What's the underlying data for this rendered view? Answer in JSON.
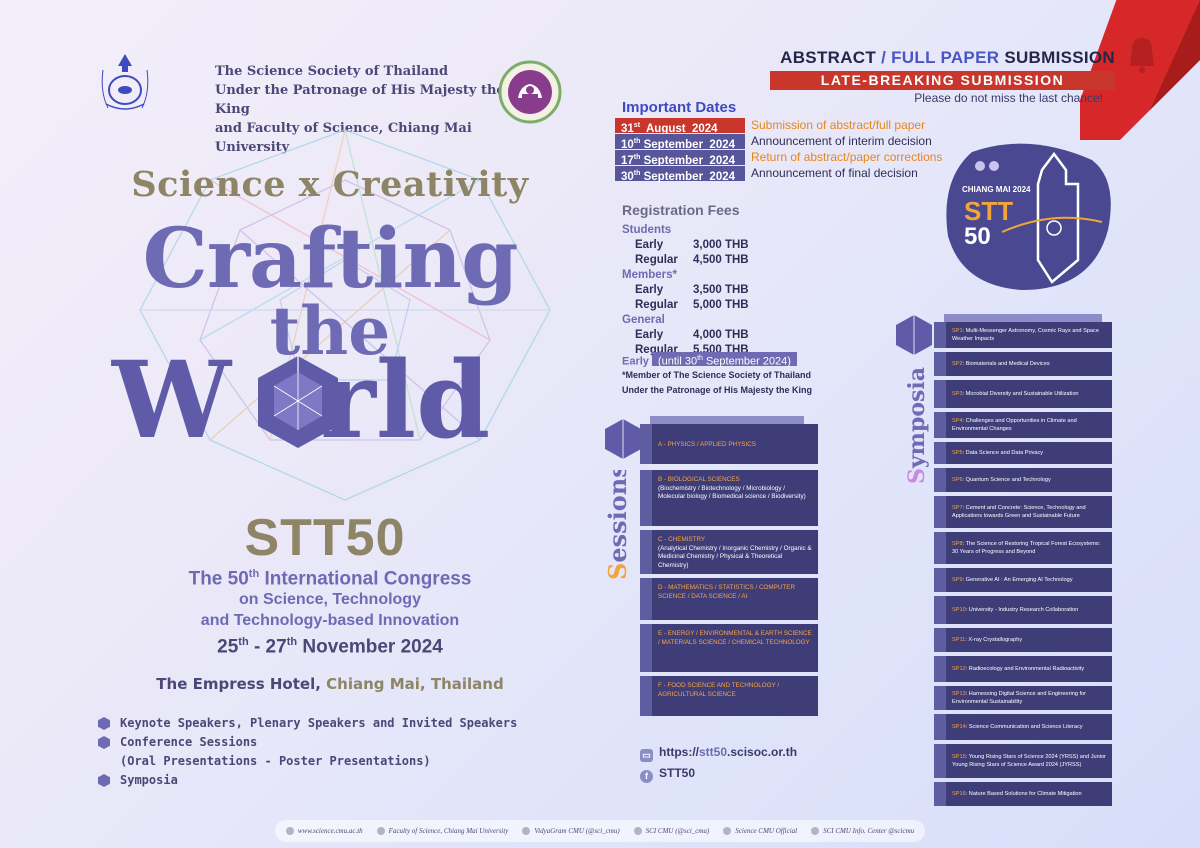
{
  "header": {
    "org_line1": "The Science Society of Thailand",
    "org_line2": "Under the Patronage of His Majesty the King",
    "org_line3": "and Faculty of Science, Chiang Mai University"
  },
  "hero": {
    "tagline": "Science x Creativity",
    "word1": "Crafting",
    "word2": "the",
    "word3_a": "W",
    "word3_b": "rld",
    "acronym": "STT50",
    "congress_prefix": "The 50",
    "congress_sup": "th",
    "congress_rest": " International Congress",
    "congress_line2": "on Science, Technology",
    "congress_line3": "and Technology-based Innovation",
    "date_start": "25",
    "date_start_sup": "th",
    "date_sep": " - 27",
    "date_end_sup": "th",
    "date_rest": " November 2024",
    "venue_main": "The Empress Hotel, ",
    "venue_city": "Chiang Mai, Thailand"
  },
  "features": [
    "Keynote Speakers, Plenary Speakers and Invited Speakers",
    "Conference Sessions",
    "(Oral Presentations - Poster Presentations)",
    "Symposia"
  ],
  "submission": {
    "title_a": "ABSTRACT ",
    "title_slash": "/ ",
    "title_b": "FULL PAPER ",
    "title_c": "SUBMISSION",
    "late": "LATE-BREAKING SUBMISSION",
    "note": "Please do not miss the last chance!"
  },
  "important_dates": {
    "title": "Important Dates",
    "rows": [
      {
        "day": "31",
        "sup": "st",
        "month": "  August  2024",
        "desc": "Submission of abstract/full paper",
        "pill_color": "#c9372c",
        "desc_color": "#e8861a"
      },
      {
        "day": "10",
        "sup": "th",
        "month": " September  2024",
        "desc": "Announcement of interim decision",
        "pill_color": "#57569a",
        "desc_color": "#2e2e58"
      },
      {
        "day": "17",
        "sup": "th",
        "month": " September  2024",
        "desc": "Return of abstract/paper corrections",
        "pill_color": "#57569a",
        "desc_color": "#e8861a"
      },
      {
        "day": "30",
        "sup": "th",
        "month": " September  2024",
        "desc": "Announcement of final decision",
        "pill_color": "#57569a",
        "desc_color": "#2e2e58"
      }
    ]
  },
  "registration": {
    "title": "Registration Fees",
    "students": "Students",
    "members": "Members*",
    "general": "General",
    "early": "Early",
    "regular": "Regular",
    "students_early": "3,000 THB",
    "students_regular": "4,500 THB",
    "members_early": "3,500 THB",
    "members_regular": "5,000 THB",
    "general_early": "4,000 THB",
    "general_regular": "5,500 THB",
    "early_label": "Early",
    "until_prefix": "(until 30",
    "until_sup": "th",
    "until_rest": " September  2024)",
    "note_line1": "*Member of The Science Society of Thailand",
    "note_line2": "Under the Patronage of His Majesty the King"
  },
  "badge": {
    "city": "CHIANG MAI 2024",
    "stt": "STT",
    "num": "50"
  },
  "sessions": {
    "heading_first": "S",
    "heading_rest": "essions",
    "items": [
      {
        "head": "A - PHYSICS / APPLIED PHYSICS",
        "body": ""
      },
      {
        "head": "B - BIOLOGICAL SCIENCES",
        "body": "(Biochemistry / Biotechnology / Microbiology / Molecular biology / Biomedical science / Biodiversity)"
      },
      {
        "head": "C - CHEMISTRY",
        "body": "(Analytical Chemistry / Inorganic Chemistry / Organic & Medicinal Chemistry / Physical & Theoretical Chemistry)"
      },
      {
        "head": "D - MATHEMATICS / STATISTICS / COMPUTER SCIENCE / DATA SCIENCE / AI",
        "body": ""
      },
      {
        "head": "E - ENERGY / ENVIRONMENTAL & EARTH SCIENCE / MATERIALS SCIENCE / CHEMICAL TECHNOLOGY",
        "body": ""
      },
      {
        "head": "F - FOOD SCIENCE AND TECHNOLOGY / AGRICULTURAL SCIENCE",
        "body": ""
      }
    ]
  },
  "symposia": {
    "heading_first": "S",
    "heading_rest": "ymposia",
    "items": [
      {
        "code": "SP1",
        "text": ": Multi-Messenger Astronomy, Cosmic Rays and Space Weather Impacts"
      },
      {
        "code": "SP2",
        "text": ": Biomaterials and Medical Devices"
      },
      {
        "code": "SP3",
        "text": ": Microbial Diversity and Sustainable Utilization"
      },
      {
        "code": "SP4",
        "text": ": Challenges and Opportunities in Climate and Environmental Changes"
      },
      {
        "code": "SP5",
        "text": ": Data Science and Data Privacy"
      },
      {
        "code": "SP6",
        "text": ": Quantum Science and Technology"
      },
      {
        "code": "SP7",
        "text": ": Cement and Concrete: Science, Technology and Applications towards Green and Sustainable Future"
      },
      {
        "code": "SP8",
        "text": ": The Science of Restoring Tropical Forest Ecosystems: 30 Years of Progress and Beyond"
      },
      {
        "code": "SP9",
        "text": ": Generative AI : An Emerging AI Technology"
      },
      {
        "code": "SP10",
        "text": ": University - Industry Research Collaboration"
      },
      {
        "code": "SP11",
        "text": ": X-ray Crystallography"
      },
      {
        "code": "SP12",
        "text": ":  Radioecology and Environmental Radioactivity"
      },
      {
        "code": "SP13",
        "text": ": Harnessing Digital Science and Engineering for Environmental Sustainability"
      },
      {
        "code": "SP14",
        "text": ": Science Communication and Science Literacy"
      },
      {
        "code": "SP15",
        "text": ": Young Rising Stars of Science 2024 (YRSS) and Junior Young Rising Stars of Science Award 2024 (JYRSS)"
      },
      {
        "code": "SP16",
        "text": ": Nature Based Solutions for Climate Mitigation"
      }
    ]
  },
  "links": {
    "site_prefix": "https://",
    "site_stt": "stt50",
    "site_rest": ".scisoc.or.th",
    "facebook": "STT50"
  },
  "footer": [
    {
      "icon": "globe-icon",
      "text": "www.science.cmu.ac.th"
    },
    {
      "icon": "facebook-icon",
      "text": "Faculty of Science, Chiang Mai University"
    },
    {
      "icon": "instagram-icon",
      "text": "VidyaGram CMU (@sci_cmu)"
    },
    {
      "icon": "twitter-icon",
      "text": "SCI CMU (@sci_cmu)"
    },
    {
      "icon": "youtube-icon",
      "text": "Science CMU Official"
    },
    {
      "icon": "line-icon",
      "text": "SCI CMU Info. Center @scicmu"
    }
  ]
}
